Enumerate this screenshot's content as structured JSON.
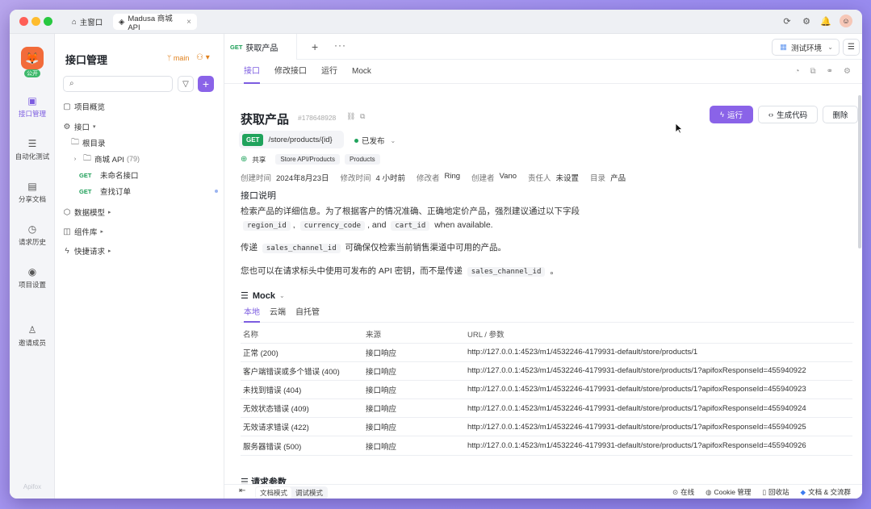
{
  "window": {
    "tabs": [
      {
        "label": "主窗口",
        "icon": "home-icon"
      },
      {
        "label": "Madusa 商城 API",
        "icon": "app-icon"
      }
    ]
  },
  "rail": {
    "badge": "公开",
    "items": [
      {
        "label": "接口管理",
        "icon": "api-icon"
      },
      {
        "label": "自动化测试",
        "icon": "automation-icon"
      },
      {
        "label": "分享文档",
        "icon": "book-icon"
      },
      {
        "label": "请求历史",
        "icon": "history-icon"
      },
      {
        "label": "项目设置",
        "icon": "settings-icon"
      },
      {
        "label": "邀请成员",
        "icon": "invite-icon"
      }
    ],
    "brand": "Apifox"
  },
  "sidebar": {
    "title": "接口管理",
    "branch": "main",
    "search_placeholder": "",
    "tree": [
      {
        "label": "项目概览"
      },
      {
        "label": "接口"
      },
      {
        "label": "根目录"
      },
      {
        "label": "商城 API",
        "count": "(79)"
      },
      {
        "method": "GET",
        "label": "未命名接口"
      },
      {
        "method": "GET",
        "label": "查找订单"
      },
      {
        "label": "数据模型"
      },
      {
        "label": "组件库"
      },
      {
        "label": "快捷请求"
      }
    ]
  },
  "topbar": {
    "tab_method": "GET",
    "tab_label": "获取产品",
    "env": "测试环境"
  },
  "subtabs": [
    "接口",
    "修改接口",
    "运行",
    "Mock"
  ],
  "endpoint": {
    "title": "获取产品",
    "id": "#178648928",
    "method": "GET",
    "path": "/store/products/{id}",
    "status": "已发布",
    "share_label": "共享",
    "tags": [
      "Store API/Products",
      "Products"
    ],
    "meta": [
      {
        "label": "创建时间",
        "value": "2024年8月23日"
      },
      {
        "label": "修改时间",
        "value": "4 小时前"
      },
      {
        "label": "修改者",
        "value": "Ring"
      },
      {
        "label": "创建者",
        "value": "Vano"
      },
      {
        "label": "责任人",
        "value": "未设置"
      },
      {
        "label": "目录",
        "value": "产品"
      }
    ]
  },
  "actions": {
    "run": "运行",
    "generate": "生成代码",
    "delete": "删除"
  },
  "description": {
    "heading": "接口说明",
    "p1_text": "检索产品的详细信息。为了根据客户的情况准确、正确地定价产品，强烈建议通过以下字段",
    "p1_codes": [
      "region_id",
      "currency_code",
      "cart_id"
    ],
    "p1_sep1": ",",
    "p1_sep2": ", and",
    "p1_tail": "when available.",
    "p2_pre": "传递",
    "p2_code": "sales_channel_id",
    "p2_post": "可确保仅检索当前销售渠道中可用的产品。",
    "p3_pre": "您也可以在请求标头中使用可发布的 API 密钥，而不是传递",
    "p3_code": "sales_channel_id",
    "p3_post": "。"
  },
  "mock": {
    "heading": "Mock",
    "tabs": [
      "本地",
      "云端",
      "自托管"
    ],
    "columns": [
      "名称",
      "来源",
      "URL / 参数"
    ],
    "rows": [
      {
        "name": "正常 (200)",
        "source": "接口响应",
        "url": "http://127.0.0.1:4523/m1/4532246-4179931-default/store/products/1"
      },
      {
        "name": "客户端错误或多个错误 (400)",
        "source": "接口响应",
        "url": "http://127.0.0.1:4523/m1/4532246-4179931-default/store/products/1?apifoxResponseId=455940922"
      },
      {
        "name": "未找到错误 (404)",
        "source": "接口响应",
        "url": "http://127.0.0.1:4523/m1/4532246-4179931-default/store/products/1?apifoxResponseId=455940923"
      },
      {
        "name": "无效状态错误 (409)",
        "source": "接口响应",
        "url": "http://127.0.0.1:4523/m1/4532246-4179931-default/store/products/1?apifoxResponseId=455940924"
      },
      {
        "name": "无效请求错误 (422)",
        "source": "接口响应",
        "url": "http://127.0.0.1:4523/m1/4532246-4179931-default/store/products/1?apifoxResponseId=455940925"
      },
      {
        "name": "服务器错误 (500)",
        "source": "接口响应",
        "url": "http://127.0.0.1:4523/m1/4532246-4179931-default/store/products/1?apifoxResponseId=455940926"
      }
    ]
  },
  "params": {
    "heading": "请求参数"
  },
  "bottombar": {
    "modes": [
      "文档模式",
      "调试模式"
    ],
    "right": [
      {
        "label": "在线",
        "icon": "online-icon"
      },
      {
        "label": "Cookie 管理",
        "icon": "cookie-icon"
      },
      {
        "label": "回收站",
        "icon": "trash-icon"
      },
      {
        "label": "文档 & 交流群",
        "icon": "community-icon"
      }
    ]
  },
  "colors": {
    "accent": "#8a63e8",
    "get": "#20a35c"
  }
}
